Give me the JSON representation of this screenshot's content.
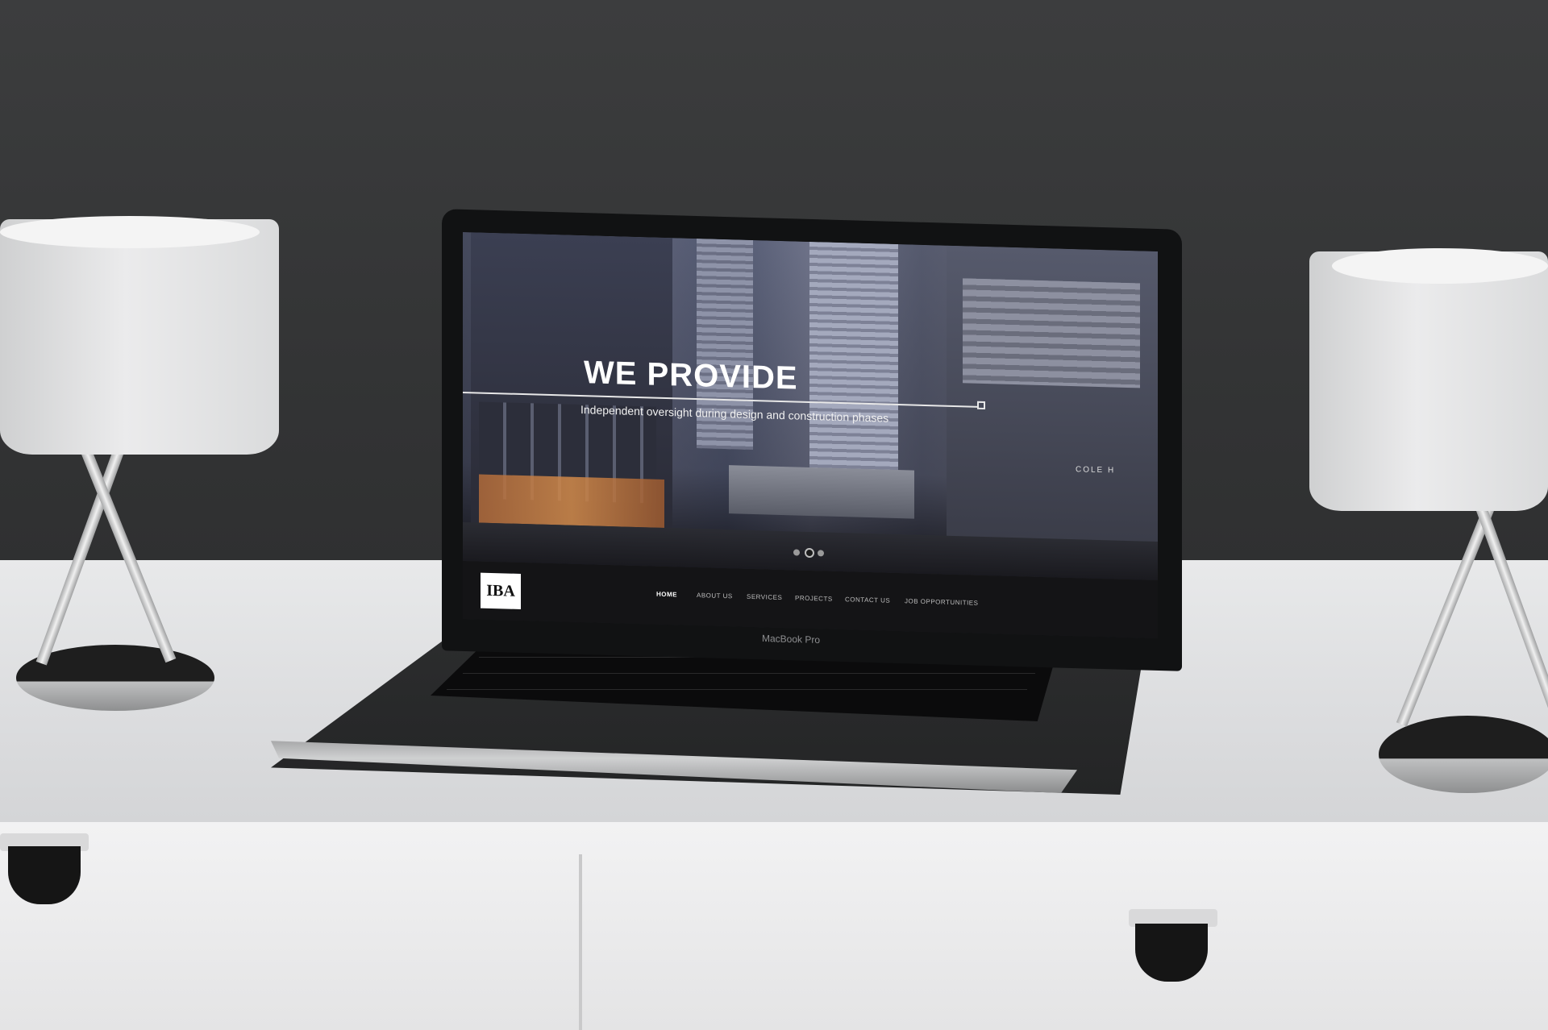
{
  "laptop": {
    "brand_label": "MacBook Pro"
  },
  "website": {
    "logo_text": "IBA",
    "hero": {
      "title": "WE PROVIDE",
      "subtitle": "Independent oversight during design and construction phases"
    },
    "slider": {
      "dot_count": 3,
      "active_index": 1
    },
    "nav": {
      "items": [
        "HOME",
        "ABOUT US",
        "SERVICES",
        "PROJECTS",
        "CONTACT US",
        "JOB OPPORTUNITIES"
      ],
      "active": "HOME"
    },
    "building_sign": "COLE H"
  },
  "colors": {
    "wall": "#3a3b3c",
    "desk": "#e4e4e5",
    "nav_bar": "#141416",
    "hero_text": "#ffffff"
  }
}
